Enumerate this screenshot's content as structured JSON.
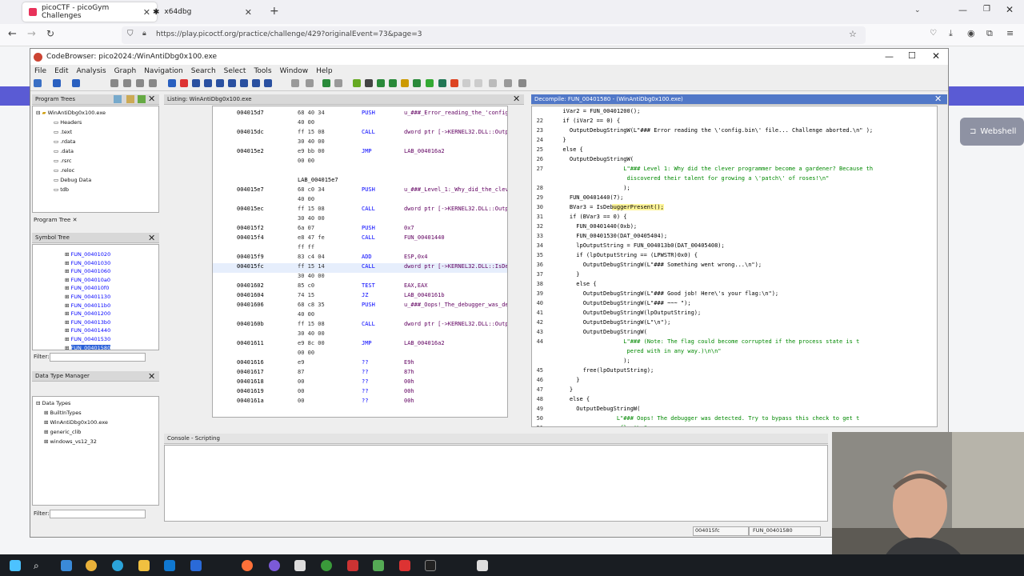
{
  "browser": {
    "tabs": [
      {
        "label": "picoCTF - picoGym Challenges",
        "active": true
      },
      {
        "label": "x64dbg",
        "active": false
      }
    ],
    "url": "https://play.picoctf.org/practice/challenge/429?originalEvent=73&page=3"
  },
  "website": {
    "webshell_label": "Webshell"
  },
  "ghidra": {
    "title": "CodeBrowser: pico2024:/WinAntiDbg0x100.exe",
    "menu": [
      "File",
      "Edit",
      "Analysis",
      "Graph",
      "Navigation",
      "Search",
      "Select",
      "Tools",
      "Window",
      "Help"
    ],
    "program_trees": {
      "title": "Program Trees",
      "root": "WinAntiDbg0x100.exe",
      "items": [
        "Headers",
        ".text",
        ".rdata",
        ".data",
        ".rsrc",
        ".reloc",
        "Debug Data",
        "tdb"
      ],
      "tab_label": "Program Tree"
    },
    "symbol_tree": {
      "title": "Symbol Tree",
      "items": [
        "FUN_00401020",
        "FUN_00401030",
        "FUN_00401060",
        "FUN_004010a0",
        "FUN_004010f0",
        "FUN_00401130",
        "FUN_004011b0",
        "FUN_00401200",
        "FUN_004013b0",
        "FUN_00401440",
        "FUN_00401530",
        "FUN_00401580"
      ],
      "selected": "FUN_00401580",
      "filter_label": "Filter:"
    },
    "data_type_manager": {
      "title": "Data Type Manager",
      "root": "Data Types",
      "items": [
        "BuiltInTypes",
        "WinAntiDbg0x100.exe",
        "generic_clib",
        "windows_vs12_32"
      ],
      "filter_label": "Filter:"
    },
    "listing": {
      "title": "Listing:  WinAntiDbg0x100.exe",
      "rows": [
        {
          "addr": "004015d7",
          "bytes": "68 40 34",
          "mnem": "PUSH",
          "ops": "u_###_Error_reading_the_'config.bi"
        },
        {
          "addr": "",
          "bytes": "40 00",
          "mnem": "",
          "ops": ""
        },
        {
          "addr": "004015dc",
          "bytes": "ff 15 08",
          "mnem": "CALL",
          "ops": "dword ptr [->KERNEL32.DLL::OutputD"
        },
        {
          "addr": "",
          "bytes": "30 40 00",
          "mnem": "",
          "ops": ""
        },
        {
          "addr": "004015e2",
          "bytes": "e9 bb 00",
          "mnem": "JMP",
          "ops": "LAB_004016a2"
        },
        {
          "addr": "",
          "bytes": "00 00",
          "mnem": "",
          "ops": ""
        },
        {
          "addr": "",
          "bytes": "",
          "mnem": "",
          "ops": ""
        },
        {
          "addr": "",
          "bytes": "",
          "mnem": "LAB_004015e7",
          "ops": ""
        },
        {
          "addr": "004015e7",
          "bytes": "68 c0 34",
          "mnem": "PUSH",
          "ops": "u_###_Level_1:_Why_did_the_clever_"
        },
        {
          "addr": "",
          "bytes": "40 00",
          "mnem": "",
          "ops": ""
        },
        {
          "addr": "004015ec",
          "bytes": "ff 15 08",
          "mnem": "CALL",
          "ops": "dword ptr [->KERNEL32.DLL::OutputD"
        },
        {
          "addr": "",
          "bytes": "30 40 00",
          "mnem": "",
          "ops": ""
        },
        {
          "addr": "004015f2",
          "bytes": "6a 07",
          "mnem": "PUSH",
          "ops": "0x7"
        },
        {
          "addr": "004015f4",
          "bytes": "e8 47 fe",
          "mnem": "CALL",
          "ops": "FUN_00401440"
        },
        {
          "addr": "",
          "bytes": "ff ff",
          "mnem": "",
          "ops": ""
        },
        {
          "addr": "004015f9",
          "bytes": "83 c4 04",
          "mnem": "ADD",
          "ops": "ESP,0x4"
        },
        {
          "addr": "004015fc",
          "bytes": "ff 15 14",
          "mnem": "CALL",
          "ops": "dword ptr [->KERNEL32.DLL::IsDebug"
        },
        {
          "addr": "",
          "bytes": "30 40 00",
          "mnem": "",
          "ops": ""
        },
        {
          "addr": "00401602",
          "bytes": "85 c0",
          "mnem": "TEST",
          "ops": "EAX,EAX"
        },
        {
          "addr": "00401604",
          "bytes": "74 15",
          "mnem": "JZ",
          "ops": "LAB_0040161b"
        },
        {
          "addr": "00401606",
          "bytes": "68 c8 35",
          "mnem": "PUSH",
          "ops": "u_###_Oops!_The_debugger_was_detec"
        },
        {
          "addr": "",
          "bytes": "40 00",
          "mnem": "",
          "ops": ""
        },
        {
          "addr": "0040160b",
          "bytes": "ff 15 08",
          "mnem": "CALL",
          "ops": "dword ptr [->KERNEL32.DLL::OutputD"
        },
        {
          "addr": "",
          "bytes": "30 40 00",
          "mnem": "",
          "ops": ""
        },
        {
          "addr": "00401611",
          "bytes": "e9 8c 00",
          "mnem": "JMP",
          "ops": "LAB_004016a2"
        },
        {
          "addr": "",
          "bytes": "00 00",
          "mnem": "",
          "ops": ""
        },
        {
          "addr": "00401616",
          "bytes": "e9",
          "mnem": "??",
          "ops": "E9h"
        },
        {
          "addr": "00401617",
          "bytes": "87",
          "mnem": "??",
          "ops": "87h"
        },
        {
          "addr": "00401618",
          "bytes": "00",
          "mnem": "??",
          "ops": "00h"
        },
        {
          "addr": "00401619",
          "bytes": "00",
          "mnem": "??",
          "ops": "00h"
        },
        {
          "addr": "0040161a",
          "bytes": "00",
          "mnem": "??",
          "ops": "00h"
        }
      ]
    },
    "decompile": {
      "title": "Decompile: FUN_00401580 - (WinAntiDbg0x100.exe)",
      "lines": [
        {
          "n": "",
          "t": "  iVar2 = FUN_00401200();"
        },
        {
          "n": "22",
          "t": "  if (iVar2 == 0) {"
        },
        {
          "n": "23",
          "t": "    OutputDebugStringW(L\"### Error reading the \\'config.bin\\' file... Challenge aborted.\\n\" );"
        },
        {
          "n": "24",
          "t": "  }"
        },
        {
          "n": "25",
          "t": "  else {"
        },
        {
          "n": "26",
          "t": "    OutputDebugStringW("
        },
        {
          "n": "27",
          "t": "                    L\"### Level 1: Why did the clever programmer become a gardener? Because th"
        },
        {
          "n": "",
          "t": "                     discovered their talent for growing a \\'patch\\' of roses!\\n\""
        },
        {
          "n": "28",
          "t": "                    );"
        },
        {
          "n": "29",
          "t": "    FUN_00401440(7);"
        },
        {
          "n": "30",
          "t": "    BVar3 = IsDebuggerPresent();"
        },
        {
          "n": "31",
          "t": "    if (BVar3 == 0) {"
        },
        {
          "n": "32",
          "t": "      FUN_00401440(0xb);"
        },
        {
          "n": "33",
          "t": "      FUN_00401530(DAT_00405404);"
        },
        {
          "n": "34",
          "t": "      lpOutputString = FUN_004013b0(DAT_00405408);"
        },
        {
          "n": "35",
          "t": "      if (lpOutputString == (LPWSTR)0x0) {"
        },
        {
          "n": "36",
          "t": "        OutputDebugStringW(L\"### Something went wrong...\\n\");"
        },
        {
          "n": "37",
          "t": "      }"
        },
        {
          "n": "38",
          "t": "      else {"
        },
        {
          "n": "39",
          "t": "        OutputDebugStringW(L\"### Good job! Here\\'s your flag:\\n\");"
        },
        {
          "n": "40",
          "t": "        OutputDebugStringW(L\"### ~~~ \");"
        },
        {
          "n": "41",
          "t": "        OutputDebugStringW(lpOutputString);"
        },
        {
          "n": "42",
          "t": "        OutputDebugStringW(L\"\\n\");"
        },
        {
          "n": "43",
          "t": "        OutputDebugStringW("
        },
        {
          "n": "44",
          "t": "                    L\"### (Note: The flag could become corrupted if the process state is t"
        },
        {
          "n": "",
          "t": "                     pered with in any way.)\\n\\n\""
        },
        {
          "n": "",
          "t": "                    );"
        },
        {
          "n": "45",
          "t": "        free(lpOutputString);"
        },
        {
          "n": "46",
          "t": "      }"
        },
        {
          "n": "47",
          "t": "    }"
        },
        {
          "n": "48",
          "t": "    else {"
        },
        {
          "n": "49",
          "t": "      OutputDebugStringW("
        },
        {
          "n": "50",
          "t": "                  L\"### Oops! The debugger was detected. Try to bypass this check to get t"
        },
        {
          "n": "51",
          "t": "                   flag!\\n\""
        }
      ]
    },
    "console": {
      "title": "Console - Scripting"
    },
    "status": {
      "address": "004015fc",
      "function": "FUN_00401580"
    }
  }
}
